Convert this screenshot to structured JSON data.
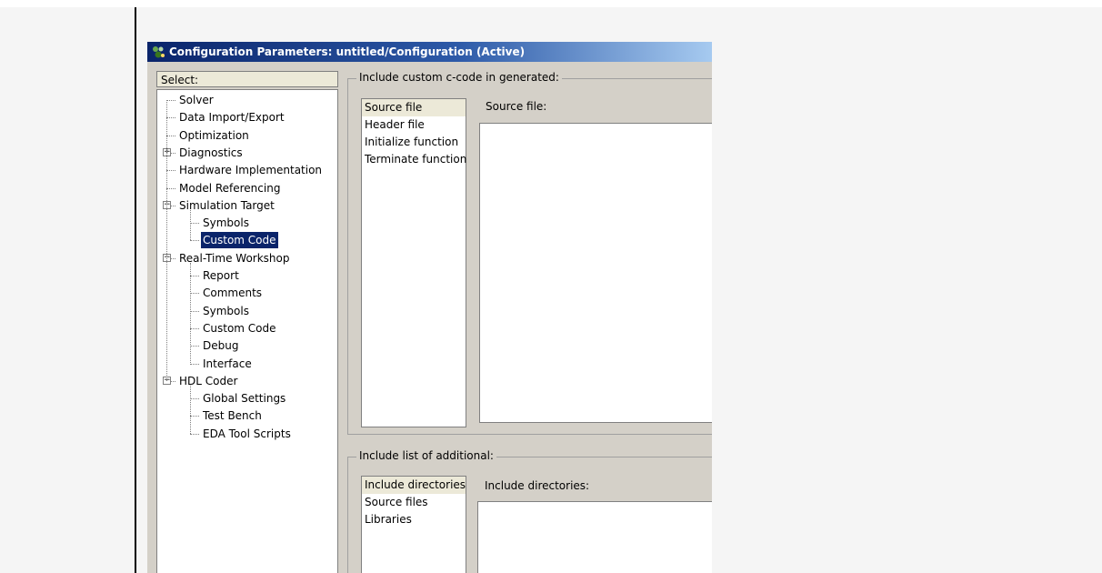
{
  "window": {
    "title": "Configuration Parameters: untitled/Configuration (Active)"
  },
  "tree": {
    "header": "Select:",
    "items": [
      {
        "label": "Solver",
        "level": 0
      },
      {
        "label": "Data Import/Export",
        "level": 0
      },
      {
        "label": "Optimization",
        "level": 0
      },
      {
        "label": "Diagnostics",
        "level": 0,
        "expander": "+"
      },
      {
        "label": "Hardware Implementation",
        "level": 0
      },
      {
        "label": "Model Referencing",
        "level": 0
      },
      {
        "label": "Simulation Target",
        "level": 0,
        "expander": "−"
      },
      {
        "label": "Symbols",
        "level": 1
      },
      {
        "label": "Custom Code",
        "level": 1,
        "selected": true
      },
      {
        "label": "Real-Time Workshop",
        "level": 0,
        "expander": "−"
      },
      {
        "label": "Report",
        "level": 1
      },
      {
        "label": "Comments",
        "level": 1
      },
      {
        "label": "Symbols",
        "level": 1
      },
      {
        "label": "Custom Code",
        "level": 1
      },
      {
        "label": "Debug",
        "level": 1
      },
      {
        "label": "Interface",
        "level": 1
      },
      {
        "label": "HDL Coder",
        "level": 0,
        "expander": "−"
      },
      {
        "label": "Global Settings",
        "level": 1
      },
      {
        "label": "Test Bench",
        "level": 1
      },
      {
        "label": "EDA Tool Scripts",
        "level": 1
      }
    ]
  },
  "custom_code": {
    "group_title": "Include custom c-code in generated:",
    "list_items": [
      "Source file",
      "Header file",
      "Initialize function",
      "Terminate function"
    ],
    "selected": "Source file",
    "field_label": "Source file:",
    "field_value": ""
  },
  "additional": {
    "group_title": "Include list of additional:",
    "list_items": [
      "Include directories",
      "Source files",
      "Libraries"
    ],
    "selected": "Include directories",
    "field_label": "Include directories:",
    "field_value": ""
  },
  "colors": {
    "titlebar_start": "#0a246a",
    "titlebar_end": "#a6caf0",
    "selection": "#0a246a",
    "dialog_bg": "#d4d0c8"
  }
}
